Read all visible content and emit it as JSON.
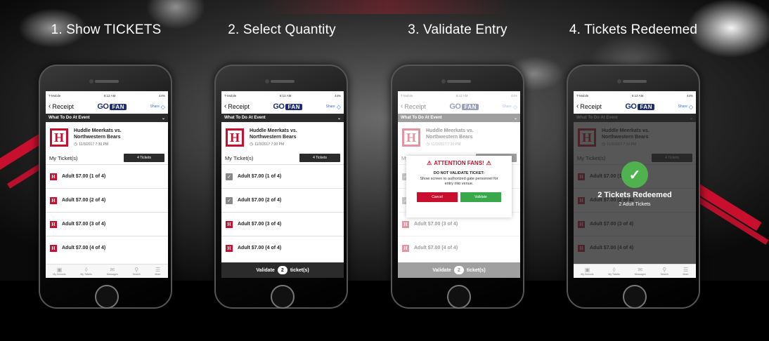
{
  "steps": [
    {
      "title": "1. Show TICKETS"
    },
    {
      "title": "2. Select Quantity"
    },
    {
      "title": "3. Validate Entry"
    },
    {
      "title": "4. Tickets Redeemed"
    }
  ],
  "status": {
    "carrier": "T-Mobile",
    "time": "8:12 AM",
    "battery": "44%"
  },
  "appbar": {
    "back_label": "Receipt",
    "logo_go": "GO",
    "logo_fan": "FAN",
    "share_label": "Share"
  },
  "section": {
    "label": "What To Do At Event"
  },
  "event": {
    "name_line1": "Huddle Meerkats vs.",
    "name_line2": "Northwestern Bears",
    "datetime": "11/3/2017 7:30 PM",
    "logo_letter": "H"
  },
  "tickets": {
    "label": "My Ticket(s)",
    "count_button": "4 Tickets",
    "items": [
      "Adult $7.00 (1 of 4)",
      "Adult $7.00 (2 of 4)",
      "Adult $7.00 (3 of 4)",
      "Adult $7.00 (4 of 4)"
    ]
  },
  "tabbar": [
    "My Schools",
    "My Tickets",
    "Messages",
    "Search",
    "More"
  ],
  "validate_bar": {
    "prefix": "Validate",
    "count": "2",
    "suffix": "ticket(s)"
  },
  "alert": {
    "title": "ATTENTION FANS!",
    "subtitle": "DO NOT VALIDATE TICKET:",
    "message": "Show screen to authorized gate personnel for entry into venue.",
    "cancel": "Cancel",
    "validate": "Validate"
  },
  "success": {
    "title": "2 Tickets Redeemed",
    "subtitle": "2 Adult Tickets"
  },
  "colors": {
    "brand_red": "#c8102e",
    "success_green": "#4fb24f",
    "validate_green": "#39a84a",
    "brand_navy": "#1d2f6f"
  }
}
